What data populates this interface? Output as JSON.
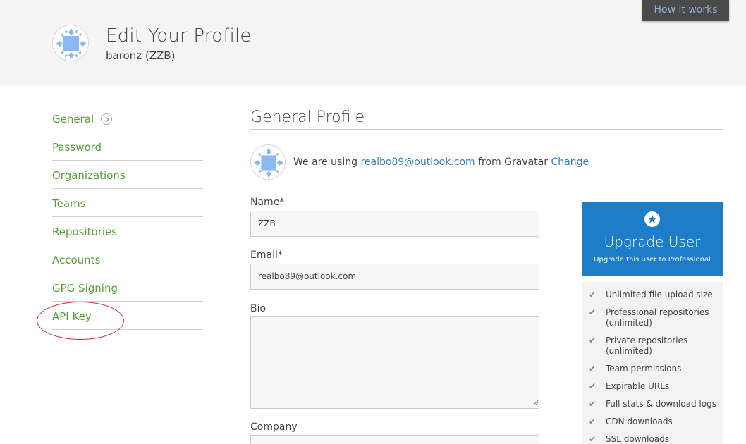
{
  "header": {
    "title": "Edit Your Profile",
    "subtitle": "baronz (ZZB)",
    "how_it_works": "How it works"
  },
  "sidebar": {
    "items": [
      {
        "label": "General"
      },
      {
        "label": "Password"
      },
      {
        "label": "Organizations"
      },
      {
        "label": "Teams"
      },
      {
        "label": "Repositories"
      },
      {
        "label": "Accounts"
      },
      {
        "label": "GPG Signing"
      },
      {
        "label": "API Key"
      }
    ]
  },
  "main": {
    "section_title": "General Profile",
    "gravatar": {
      "prefix": "We are using",
      "email": "realbo89@outlook.com",
      "middle": "from Gravatar",
      "change": "Change"
    },
    "fields": {
      "name_label": "Name*",
      "name_value": "ZZB",
      "email_label": "Email*",
      "email_value": "realbo89@outlook.com",
      "bio_label": "Bio",
      "company_label": "Company"
    }
  },
  "upgrade": {
    "title": "Upgrade User",
    "subtitle": "Upgrade this user to Professional",
    "features": [
      "Unlimited file upload size",
      "Professional repositories\n(unlimited)",
      "Private repositories\n(unlimited)",
      "Team permissions",
      "Expirable URLs",
      "Full stats & download logs",
      "CDN downloads",
      "SSL downloads"
    ]
  },
  "colors": {
    "accent_green": "#5a9e3a",
    "link_blue": "#3a7bbf",
    "upgrade_blue": "#1e7dc8",
    "annotation_red": "#d83030"
  }
}
